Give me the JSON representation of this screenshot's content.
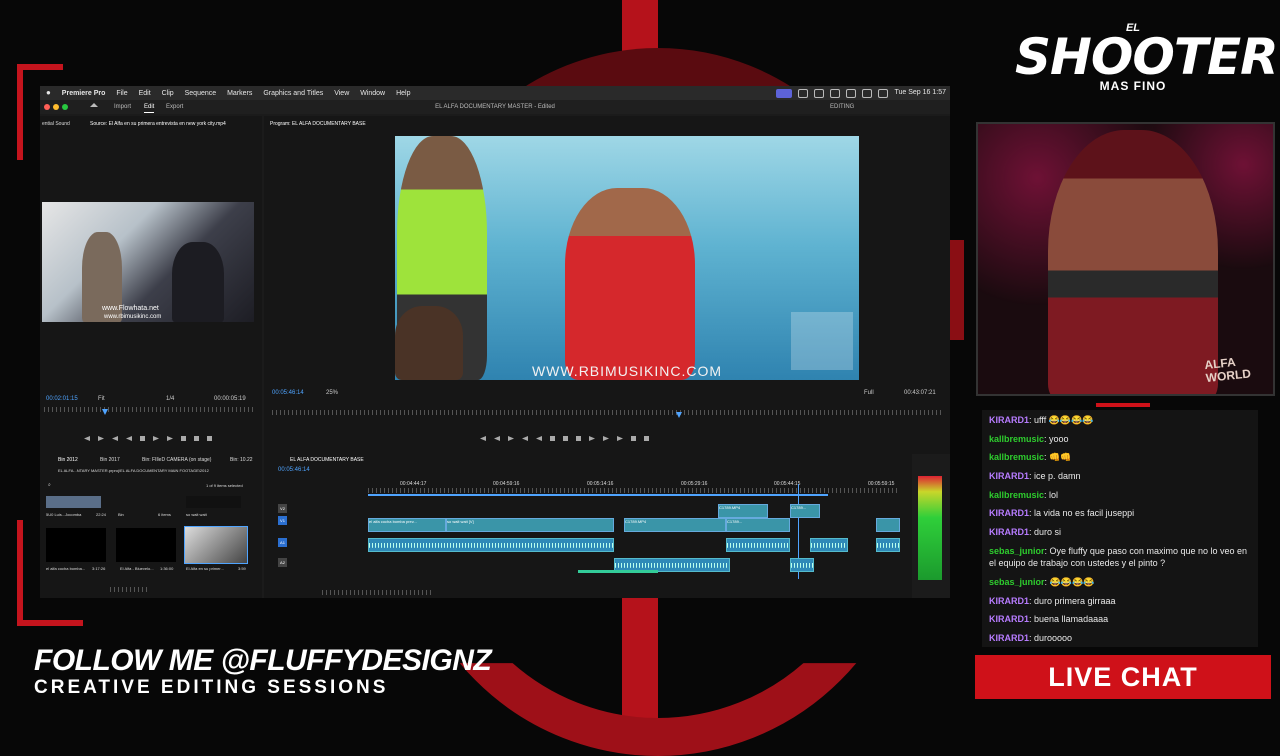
{
  "menubar": {
    "app_name": "Premiere Pro",
    "items": [
      "File",
      "Edit",
      "Clip",
      "Sequence",
      "Markers",
      "Graphics and Titles",
      "View",
      "Window",
      "Help"
    ],
    "clock": "Tue Sep 16 1:57"
  },
  "window": {
    "title": "EL ALFA DOCUMENTARY MASTER - Edited",
    "workspace_tabs": [
      "Import",
      "Edit",
      "Export"
    ],
    "active_tab": "Edit",
    "workspace_label": "EDITING"
  },
  "source_monitor": {
    "left_tab": "ential Sound",
    "tab": "Source: El Alfa en su primera entrevista en new york city.mp4",
    "timecode": "00:02:01:15",
    "fit_label": "Fit",
    "res_label": "1/4",
    "duration": "00:00:05:19",
    "watermark": "www.Flowhata.net",
    "watermark2": "www.rbimusikinc.com"
  },
  "program_monitor": {
    "tab": "Program: EL ALFA DOCUMENTARY BASE",
    "timecode": "00:05:46:14",
    "zoom": "25%",
    "quality": "Full",
    "duration": "00:43:07:21",
    "watermark": "WWW.RBIMUSIKINC.COM"
  },
  "project_panel": {
    "tabs": [
      "Bin 2012",
      "Bin 2017",
      "Bin: FIlleD CAMERA (on stage)",
      "Bin: 10.22"
    ],
    "path": "EL ALFA...NTARY MASTER.prproj\\EL ALFA DOCUMENTARY MAIN FOOTAGE\\2012",
    "item_count": "1 of 9 items selected",
    "items": [
      {
        "name": "5U0 Luis...Jocomba",
        "dur": "22:24"
      },
      {
        "name": "Bin",
        "dur": "6 items"
      },
      {
        "name": "so wait wait",
        "dur": ""
      },
      {
        "name": "el alfa cocha bomba...",
        "dur": "3:17:26"
      },
      {
        "name": "El Alfa - Bluevelo...",
        "dur": "1:36:00"
      },
      {
        "name": "El Alfa en su primer...",
        "dur": "3:59"
      }
    ]
  },
  "timeline": {
    "tab": "EL ALFA DOCUMENTARY BASE",
    "timecode": "00:05:46:14",
    "ruler_labels": [
      "00:04:44:17",
      "00:04:59:16",
      "00:05:14:16",
      "00:05:29:16",
      "00:05:44:15",
      "00:05:59:15"
    ],
    "tracks": [
      "V2",
      "V1",
      "A1",
      "A2"
    ],
    "clips": [
      "el alfa cocha bomba prev...",
      "so wait wait [V]",
      "C1789.MP4",
      "C1789.MP4",
      "C1789...",
      "C1789..."
    ]
  },
  "overlay": {
    "logo_top": "EL",
    "logo_main": "SHOOTER",
    "logo_sub": "MAS FINO",
    "webcam_caption": "ALFA WORLD",
    "follow": "FOLLOW ME @FLUFFYDESIGNZ",
    "creative": "CREATIVE EDITING SESSIONS",
    "live_chat": "LIVE CHAT"
  },
  "chat": [
    {
      "user": "KIRARD1",
      "msg": "ufff 😂😂😂😂",
      "color": "#b77cff"
    },
    {
      "user": "kallbremusic",
      "msg": "yooo",
      "color": "#2ecc2e"
    },
    {
      "user": "kallbremusic",
      "msg": "👊👊",
      "color": "#2ecc2e"
    },
    {
      "user": "KIRARD1",
      "msg": "ice p. damn",
      "color": "#b77cff"
    },
    {
      "user": "kallbremusic",
      "msg": "lol",
      "color": "#2ecc2e"
    },
    {
      "user": "KIRARD1",
      "msg": "la vida no es facil juseppi",
      "color": "#b77cff"
    },
    {
      "user": "KIRARD1",
      "msg": "duro si",
      "color": "#b77cff"
    },
    {
      "user": "sebas_junior",
      "msg": "Oye fluffy que paso con maximo que no lo veo en el equipo de trabajo con ustedes y el pinto ?",
      "color": "#2ecc2e"
    },
    {
      "user": "sebas_junior",
      "msg": "😂😂😂😂",
      "color": "#2ecc2e"
    },
    {
      "user": "KIRARD1",
      "msg": "duro primera girraaa",
      "color": "#b77cff"
    },
    {
      "user": "KIRARD1",
      "msg": "buena llamadaaaa",
      "color": "#b77cff"
    },
    {
      "user": "KIRARD1",
      "msg": "durooooo",
      "color": "#b77cff"
    }
  ],
  "colors": {
    "accent_red": "#cf1119",
    "premiere_blue": "#4fa4ff",
    "clip_teal": "#3a95a8"
  }
}
